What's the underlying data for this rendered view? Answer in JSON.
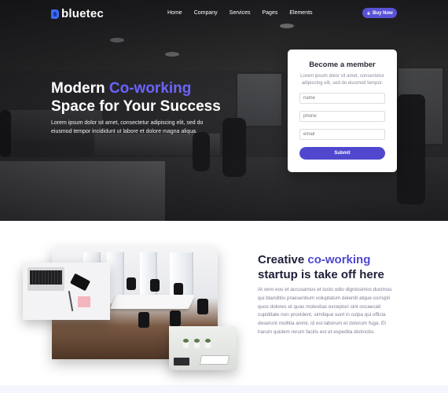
{
  "brand": {
    "name": "bluetec"
  },
  "nav": {
    "items": [
      "Home",
      "Company",
      "Services",
      "Pages",
      "Elements"
    ],
    "cta": {
      "icon": "download-icon",
      "label": "Buy Now"
    }
  },
  "hero": {
    "title_line1_prefix": "Modern ",
    "title_line1_accent": "Co-working",
    "title_line2": "Space for Your Success",
    "description": "Lorem ipsum dolor sit amet, consectetur adipiscing elit, sed do eiusmod tempor incididunt ut labore et dolore magna aliqua."
  },
  "member_form": {
    "title": "Become a member",
    "description": "Lorem ipsum dolor sit amet, consectetur adipiscing elit, sed do eiusmod tempor.",
    "fields": [
      {
        "placeholder": "name"
      },
      {
        "placeholder": "phone"
      },
      {
        "placeholder": "email"
      }
    ],
    "submit_label": "Submit"
  },
  "about": {
    "title_prefix": "Creative ",
    "title_accent": "co-working",
    "title_rest": "startup is take off here",
    "description": "At vero eos et accusamus et iusto odio dignissimos ducimus qui blanditiis praesentium voluptatum deleniti atque corrupti quos dolores et quas molestias excepturi sint occaecati cupiditate non provident, similique sunt in culpa qui officia deserunt mollitia animi, id est laborum et dolorum fuga. Et harum quidem rerum facilis est et expedita distinctio."
  },
  "colors": {
    "accent": "#5a52d6",
    "logo_blue": "#3b6cf6",
    "heading_dark": "#1e1f3a",
    "body_muted": "#7d7f95"
  }
}
